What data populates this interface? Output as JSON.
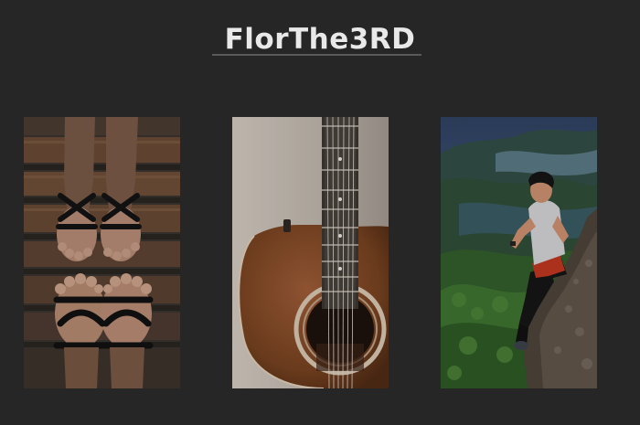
{
  "header": {
    "title": "FlorThe3RD"
  },
  "gallery": {
    "photos": [
      {
        "subject": "feet-in-sandals-on-wooden-steps"
      },
      {
        "subject": "acoustic-guitar-against-wall"
      },
      {
        "subject": "man-sitting-on-mountain-rock"
      }
    ]
  },
  "colors": {
    "background": "#262626",
    "title_text": "#e9e9e9",
    "divider": "#5a5a5a"
  }
}
